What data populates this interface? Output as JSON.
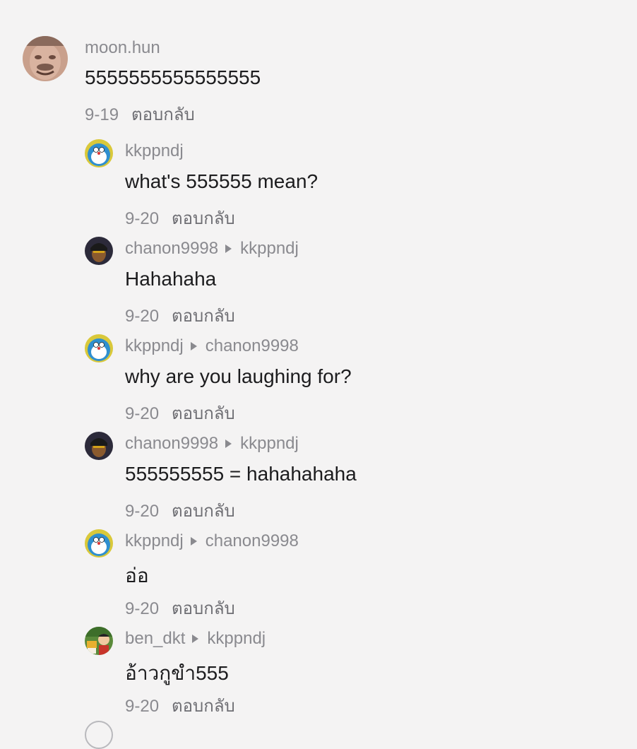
{
  "comments": [
    {
      "avatar": "face-photo-avatar",
      "user": "moon.hun",
      "reply_to": null,
      "text": "5555555555555555",
      "date": "9-19",
      "reply_label": "ตอบกลับ"
    },
    {
      "avatar": "doraemon-avatar",
      "user": "kkppndj",
      "reply_to": null,
      "text": "what's 555555 mean?",
      "date": "9-20",
      "reply_label": "ตอบกลับ"
    },
    {
      "avatar": "dark-portrait-avatar",
      "user": "chanon9998",
      "reply_to": "kkppndj",
      "text": "Hahahaha",
      "date": "9-20",
      "reply_label": "ตอบกลับ"
    },
    {
      "avatar": "doraemon-avatar",
      "user": "kkppndj",
      "reply_to": "chanon9998",
      "text": "why are you laughing for?",
      "date": "9-20",
      "reply_label": "ตอบกลับ"
    },
    {
      "avatar": "dark-portrait-avatar",
      "user": "chanon9998",
      "reply_to": "kkppndj",
      "text": "555555555 = hahahahaha",
      "date": "9-20",
      "reply_label": "ตอบกลับ"
    },
    {
      "avatar": "doraemon-avatar",
      "user": "kkppndj",
      "reply_to": "chanon9998",
      "text": "อ่อ",
      "date": "9-20",
      "reply_label": "ตอบกลับ"
    },
    {
      "avatar": "cartoon-avatar",
      "user": "ben_dkt",
      "reply_to": "kkppndj",
      "text": "อ้าวกูขำ555",
      "date": "9-20",
      "reply_label": "ตอบกลับ"
    }
  ],
  "colors": {
    "background": "#f4f3f3",
    "username": "#8a8a8f",
    "text": "#1c1c1e"
  }
}
